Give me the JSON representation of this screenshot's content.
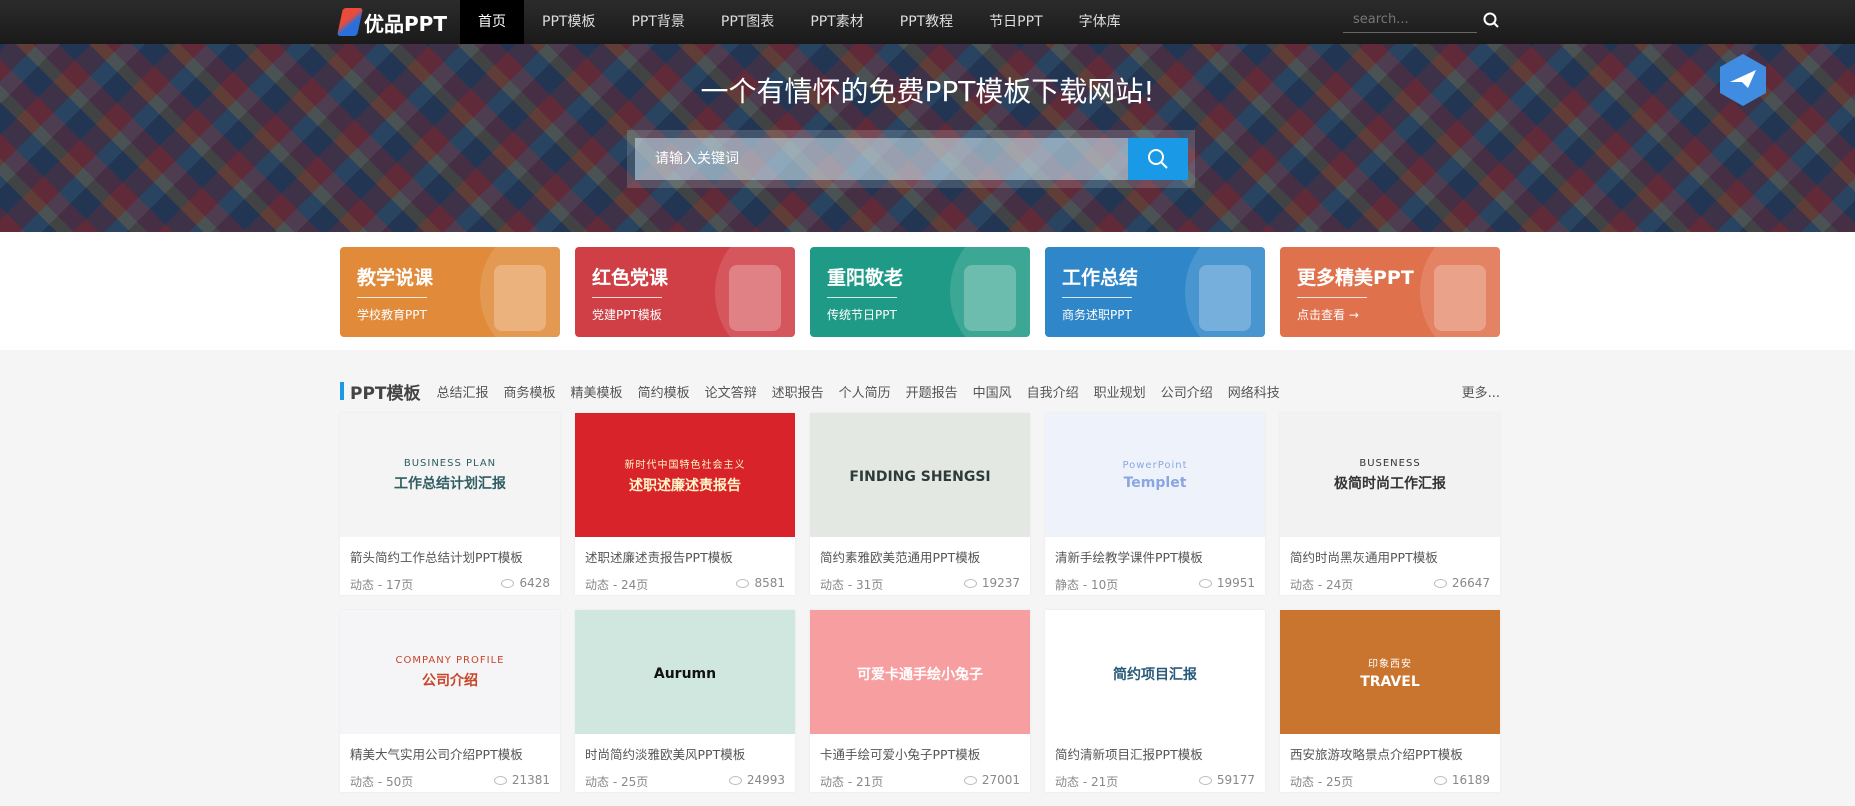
{
  "nav": {
    "logo": "优品PPT",
    "items": [
      "首页",
      "PPT模板",
      "PPT背景",
      "PPT图表",
      "PPT素材",
      "PPT教程",
      "节日PPT",
      "字体库"
    ],
    "search_placeholder": "search..."
  },
  "banner": {
    "title": "一个有情怀的免费PPT模板下载网站!",
    "search_placeholder": "请输入关键词"
  },
  "categories": [
    {
      "title": "教学说课",
      "sub": "学校教育PPT",
      "color": "#e08a3a"
    },
    {
      "title": "红色党课",
      "sub": "党建PPT模板",
      "color": "#cf3f45"
    },
    {
      "title": "重阳敬老",
      "sub": "传统节日PPT",
      "color": "#1f9a86"
    },
    {
      "title": "工作总结",
      "sub": "商务述职PPT",
      "color": "#2f86c8"
    },
    {
      "title": "更多精美PPT",
      "sub": "点击查看 →",
      "color": "#e0714d"
    }
  ],
  "section": {
    "title": "PPT模板",
    "tags": [
      "总结汇报",
      "商务模板",
      "精美模板",
      "简约模板",
      "论文答辩",
      "述职报告",
      "个人简历",
      "开题报告",
      "中国风",
      "自我介绍",
      "职业规划",
      "公司介绍",
      "网络科技"
    ],
    "more": "更多..."
  },
  "cards": [
    {
      "title": "箭头简约工作总结计划PPT模板",
      "meta": "动态 - 17页",
      "views": "6428",
      "thumb_a": "BUSINESS PLAN",
      "thumb_b": "工作总结计划汇报",
      "bg": "#f4f4f4",
      "fg": "#2f5d63"
    },
    {
      "title": "述职述廉述责报告PPT模板",
      "meta": "动态 - 24页",
      "views": "8581",
      "thumb_a": "新时代中国特色社会主义",
      "thumb_b": "述职述廉述责报告",
      "bg": "#d9232a",
      "fg": "#fff4c8"
    },
    {
      "title": "简约素雅欧美范通用PPT模板",
      "meta": "动态 - 31页",
      "views": "19237",
      "thumb_a": "",
      "thumb_b": "FINDING SHENGSI",
      "bg": "#e4e8e2",
      "fg": "#2e3b3a"
    },
    {
      "title": "清新手绘教学课件PPT模板",
      "meta": "静态 - 10页",
      "views": "19951",
      "thumb_a": "PowerPoint",
      "thumb_b": "Templet",
      "bg": "#eef3fb",
      "fg": "#8aa6e0"
    },
    {
      "title": "简约时尚黑灰通用PPT模板",
      "meta": "动态 - 24页",
      "views": "26647",
      "thumb_a": "BUSENESS",
      "thumb_b": "极简时尚工作汇报",
      "bg": "#f2f2f2",
      "fg": "#333"
    },
    {
      "title": "精美大气实用公司介绍PPT模板",
      "meta": "动态 - 50页",
      "views": "21381",
      "thumb_a": "COMPANY PROFILE",
      "thumb_b": "公司介绍",
      "bg": "#f5f5f7",
      "fg": "#c8452a"
    },
    {
      "title": "时尚简约淡雅欧美风PPT模板",
      "meta": "动态 - 25页",
      "views": "24993",
      "thumb_a": "",
      "thumb_b": "Aurumn",
      "bg": "#cfe7df",
      "fg": "#111"
    },
    {
      "title": "卡通手绘可爱小兔子PPT模板",
      "meta": "动态 - 21页",
      "views": "27001",
      "thumb_a": "",
      "thumb_b": "可爱卡通手绘小兔子",
      "bg": "#f79ea0",
      "fg": "#fff"
    },
    {
      "title": "简约清新项目汇报PPT模板",
      "meta": "动态 - 21页",
      "views": "59177",
      "thumb_a": "",
      "thumb_b": "简约项目汇报",
      "bg": "#ffffff",
      "fg": "#2a5a7a"
    },
    {
      "title": "西安旅游攻略景点介绍PPT模板",
      "meta": "动态 - 25页",
      "views": "16189",
      "thumb_a": "印象西安",
      "thumb_b": "TRAVEL",
      "bg": "#c9752f",
      "fg": "#fff"
    }
  ]
}
